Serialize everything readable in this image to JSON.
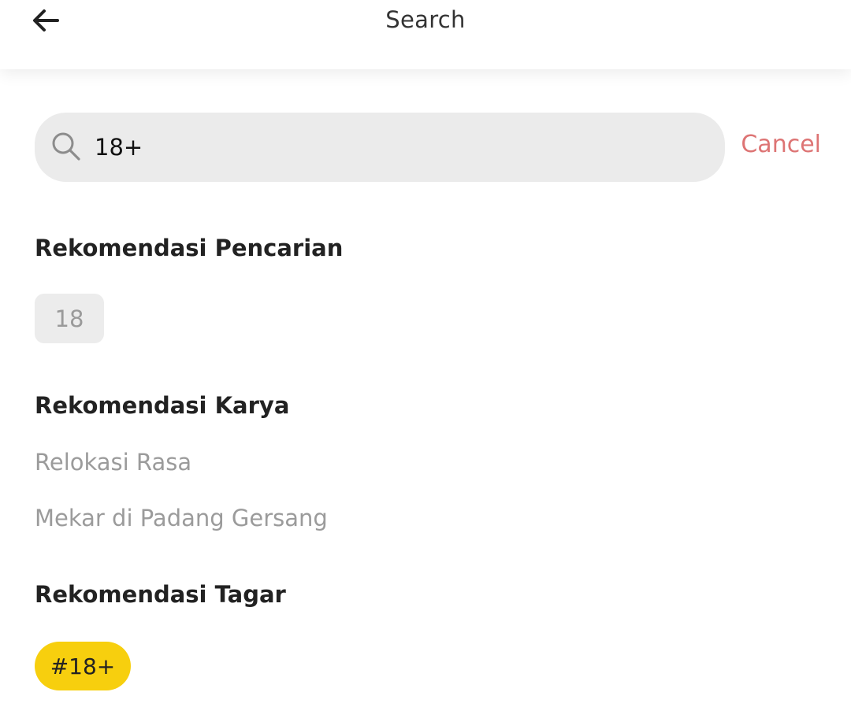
{
  "header": {
    "title": "Search",
    "back_icon": "arrow-left-icon"
  },
  "search": {
    "value": "18+",
    "icon": "search-icon",
    "cancel_label": "Cancel"
  },
  "sections": {
    "search_recommendations": {
      "heading": "Rekomendasi Pencarian",
      "chips": [
        "18"
      ]
    },
    "work_recommendations": {
      "heading": "Rekomendasi Karya",
      "items": [
        "Relokasi Rasa",
        "Mekar di Padang Gersang"
      ]
    },
    "tag_recommendations": {
      "heading": "Rekomendasi Tagar",
      "tags": [
        "#18+"
      ]
    }
  },
  "colors": {
    "cancel": "#dd7474",
    "tag_chip": "#f7cf0e",
    "search_box": "#ebebeb"
  }
}
